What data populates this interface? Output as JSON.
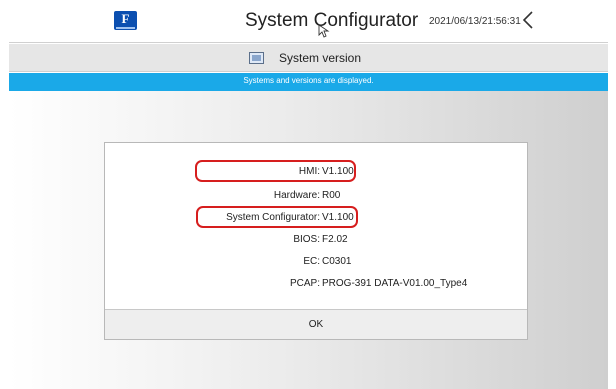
{
  "header": {
    "title": "System Configurator",
    "datetime": "2021/06/13/21:56:31",
    "back_glyph": "<",
    "logo_text": "F"
  },
  "subheader": {
    "title": "System version",
    "icon": "version-icon"
  },
  "banner": {
    "text": "Systems and versions are displayed."
  },
  "dialog": {
    "rows": [
      {
        "label": "HMI:",
        "value": "V1.100",
        "highlighted": true
      },
      {
        "label": "Hardware:",
        "value": "R00",
        "highlighted": false
      },
      {
        "label": "System Configurator:",
        "value": "V1.100",
        "highlighted": true
      },
      {
        "label": "BIOS:",
        "value": "F2.02",
        "highlighted": false
      },
      {
        "label": "EC:",
        "value": "C0301",
        "highlighted": false
      },
      {
        "label": "PCAP:",
        "value": "PROG-391 DATA-V01.00_Type4",
        "highlighted": false
      }
    ],
    "ok_label": "OK"
  },
  "colors": {
    "banner": "#1aa9e8",
    "highlight": "#d61e1e",
    "logo": "#0b4fb0"
  }
}
